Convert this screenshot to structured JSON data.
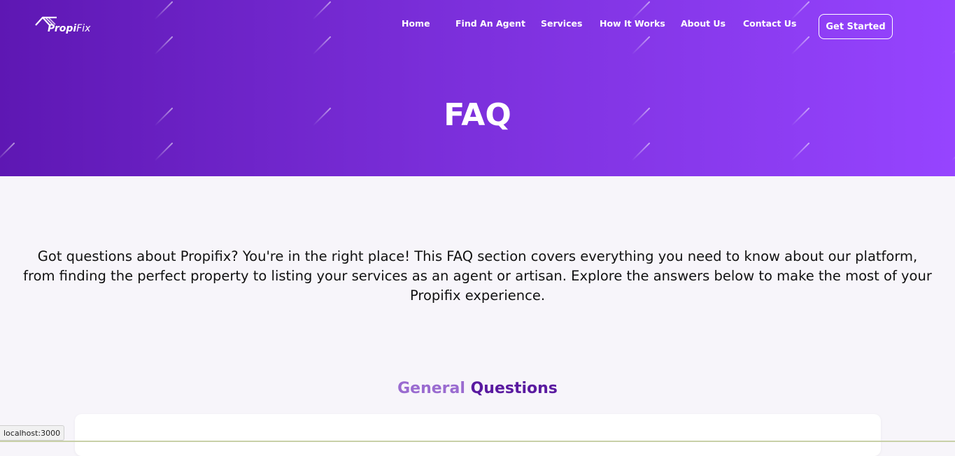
{
  "header": {
    "logo": {
      "text_propi": "Propi",
      "text_fix": "Fix",
      "icon": "house-roof-icon"
    },
    "nav": [
      {
        "label": "Home"
      },
      {
        "label": "Find An Agent"
      },
      {
        "label": "Services"
      },
      {
        "label": "How It Works"
      },
      {
        "label": "About Us"
      },
      {
        "label": "Contact Us"
      }
    ],
    "cta_label": "Get Started"
  },
  "hero": {
    "title": "FAQ"
  },
  "intro": {
    "text": "Got questions about Propifix? You're in the right place! This FAQ section covers everything you need to know about our platform, from finding the perfect property to listing your services as an agent or artisan. Explore the answers below to make the most of your Propifix experience."
  },
  "section": {
    "title_part1": "General",
    "title_part2": "Questions"
  },
  "status_bar": {
    "url": "localhost:3000"
  },
  "colors": {
    "hero_gradient_start": "#5e17b3",
    "hero_gradient_end": "#9644ff",
    "title_accent_light": "#9a6bd0",
    "title_accent_dark": "#5a1aa0",
    "page_background": "#f7f5fa"
  }
}
